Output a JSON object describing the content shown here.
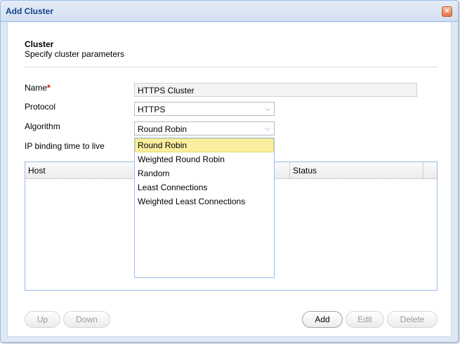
{
  "window": {
    "title": "Add Cluster",
    "close_glyph": "×"
  },
  "section": {
    "title": "Cluster",
    "subtitle": "Specify cluster parameters"
  },
  "form": {
    "name_label": "Name",
    "required_mark": "*",
    "name_value": "HTTPS Cluster",
    "protocol_label": "Protocol",
    "protocol_value": "HTTPS",
    "algorithm_label": "Algorithm",
    "algorithm_value": "Round Robin",
    "ip_binding_label": "IP binding time to live",
    "combo_glyph": "⌵"
  },
  "dropdown": {
    "options": [
      "Round Robin",
      "Weighted Round Robin",
      "Random",
      "Least Connections",
      "Weighted Least Connections"
    ],
    "selected_index": 0
  },
  "grid": {
    "columns": [
      "Host",
      "Status"
    ]
  },
  "buttons": {
    "up": "Up",
    "down": "Down",
    "add": "Add",
    "edit": "Edit",
    "delete": "Delete"
  },
  "colors": {
    "title": "#15428b",
    "required": "#d40000",
    "selected_option": "#fcee9f",
    "border_accent": "#99bbe8"
  }
}
